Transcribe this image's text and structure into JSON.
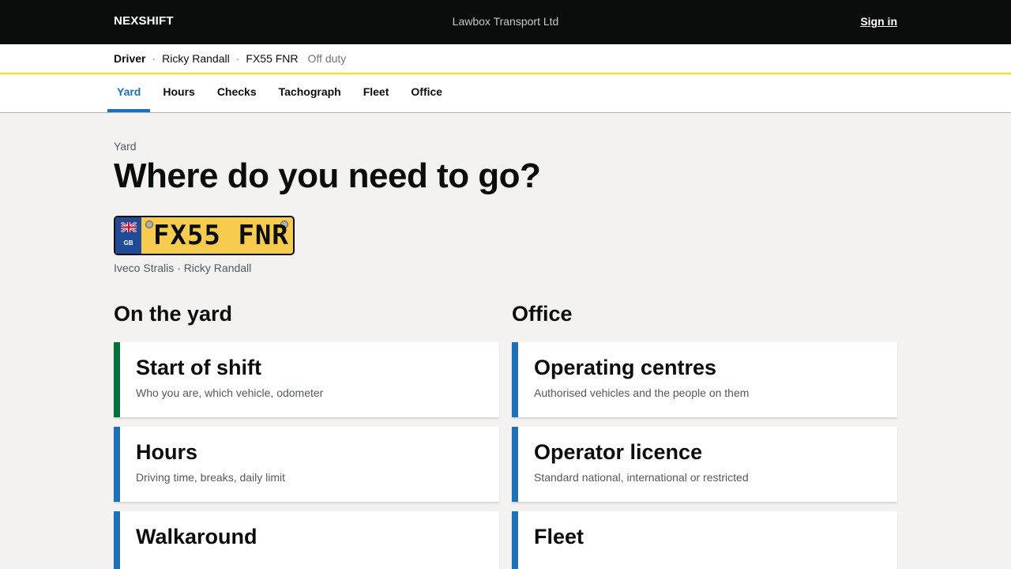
{
  "header": {
    "brand": "NEXSHIFT",
    "organisation": "Lawbox Transport Ltd",
    "signin_label": "Sign in"
  },
  "driver_bar": {
    "role": "Driver",
    "name": "Ricky Randall",
    "vehicle": "FX55 FNR",
    "status": "Off duty",
    "separator": "·"
  },
  "nav": {
    "tabs": [
      {
        "label": "Yard",
        "active": true
      },
      {
        "label": "Hours",
        "active": false
      },
      {
        "label": "Checks",
        "active": false
      },
      {
        "label": "Tachograph",
        "active": false
      },
      {
        "label": "Fleet",
        "active": false
      },
      {
        "label": "Office",
        "active": false
      }
    ]
  },
  "page": {
    "breadcrumb": "Yard",
    "title": "Where do you need to go?"
  },
  "plate": {
    "registration": "FX55 FNR",
    "country": "GB",
    "flag_icon": "union-flag-icon"
  },
  "vehicle_caption": "Iveco Stralis · Ricky Randall",
  "sections": {
    "yard": {
      "heading": "On the yard",
      "cards": [
        {
          "title": "Start of shift",
          "desc": "Who you are, which vehicle, odometer",
          "accent": "#00703c"
        },
        {
          "title": "Hours",
          "desc": "Driving time, breaks, daily limit",
          "accent": "#1d70b8"
        },
        {
          "title": "Walkaround",
          "desc": "",
          "accent": "#1d70b8"
        }
      ]
    },
    "office": {
      "heading": "Office",
      "cards": [
        {
          "title": "Operating centres",
          "desc": "Authorised vehicles and the people on them",
          "accent": "#1d70b8"
        },
        {
          "title": "Operator licence",
          "desc": "Standard national, international or restricted",
          "accent": "#1d70b8"
        },
        {
          "title": "Fleet",
          "desc": "",
          "accent": "#1d70b8"
        }
      ]
    }
  },
  "colors": {
    "topbar": "#0b0c0c",
    "accent_blue": "#1d70b8",
    "accent_green": "#00703c",
    "highlight_yellow": "#ffdd00",
    "plate_yellow": "#f7cb4d"
  }
}
